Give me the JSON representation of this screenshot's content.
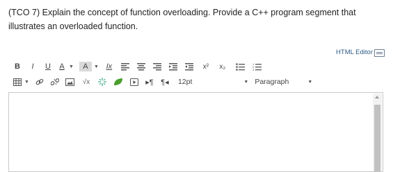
{
  "question": {
    "text": "(TCO 7) Explain the concept of function overloading. Provide a C++ program segment that illustrates an overloaded function."
  },
  "editor_link": {
    "label": "HTML Editor",
    "icon": "keyboard-icon"
  },
  "toolbar": {
    "bold": "B",
    "italic": "I",
    "underline": "U",
    "text_color": "A",
    "background_color": "A",
    "clear_format": "Ix",
    "superscript": "x²",
    "subscript": "x₂",
    "font_size": "12pt",
    "block_format": "Paragraph",
    "icons": [
      "align-left-icon",
      "align-center-icon",
      "align-right-icon",
      "indent-icon",
      "outdent-icon",
      "bullet-list-icon",
      "numbered-list-icon",
      "table-icon",
      "link-icon",
      "unlink-icon",
      "image-icon",
      "math-icon",
      "sparkle-icon",
      "leaf-icon",
      "media-icon",
      "ltr-icon",
      "rtl-icon"
    ]
  },
  "editor": {
    "content": ""
  },
  "colors": {
    "accent_link": "#2d5b86",
    "leaf": "#4a9e2f",
    "sparkle": "#3aaa8a"
  }
}
